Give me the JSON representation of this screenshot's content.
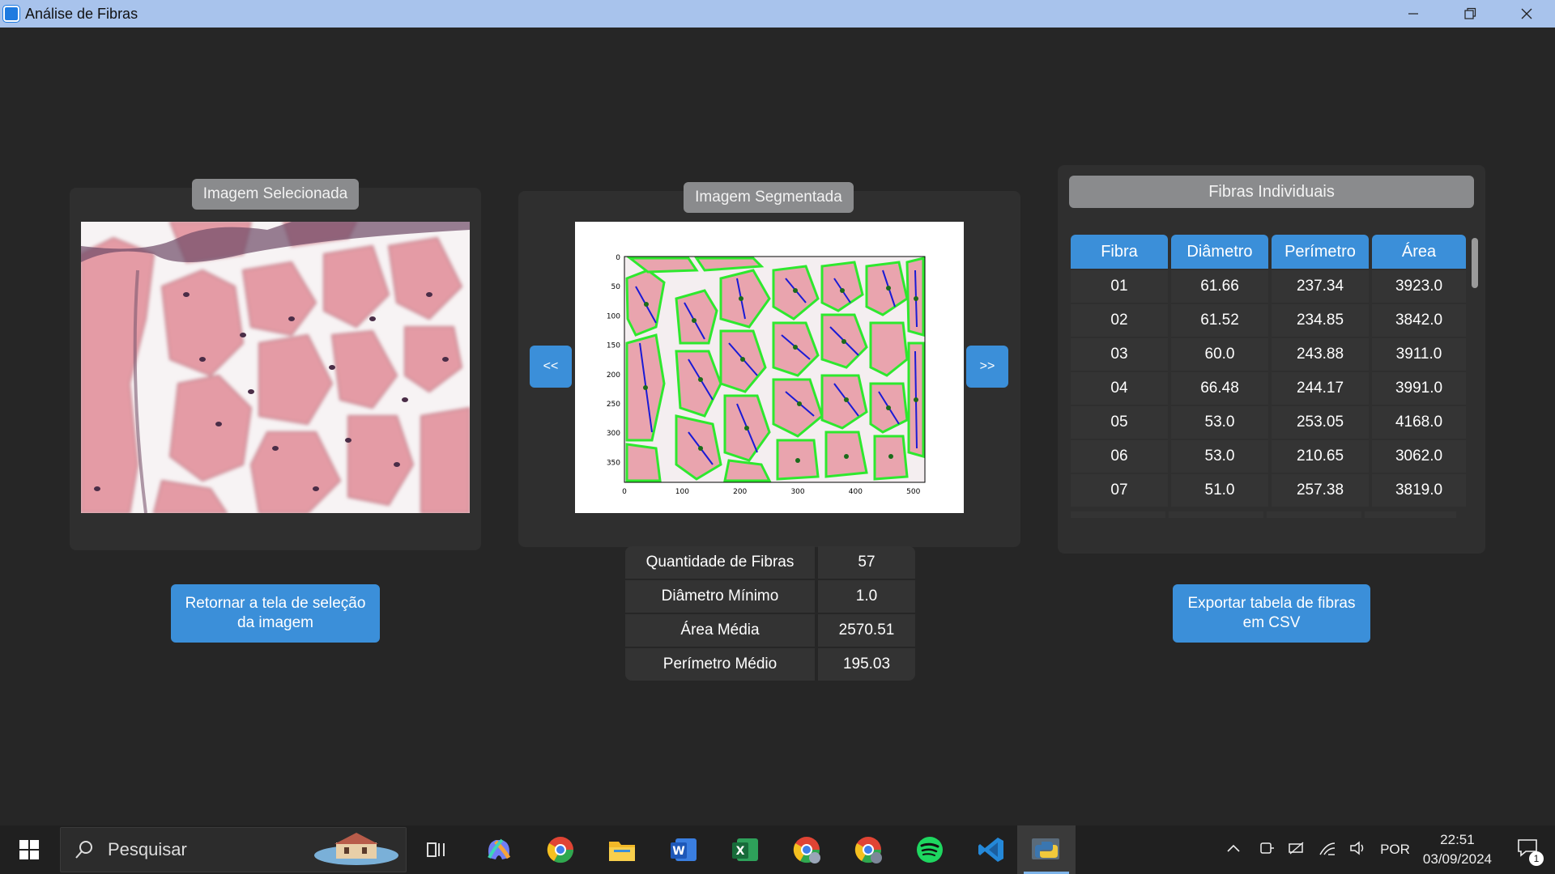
{
  "window": {
    "title": "Análise de Fibras"
  },
  "selected": {
    "label": "Imagem Selecionada"
  },
  "segmented": {
    "label": "Imagem Segmentada",
    "prev": "<<",
    "next": ">>",
    "x_ticks": [
      "0",
      "100",
      "200",
      "300",
      "400",
      "500"
    ],
    "y_ticks": [
      "0",
      "50",
      "100",
      "150",
      "200",
      "250",
      "300",
      "350"
    ]
  },
  "fibras": {
    "title": "Fibras Individuais",
    "headers": [
      "Fibra",
      "Diâmetro",
      "Perímetro",
      "Área"
    ],
    "rows": [
      [
        "01",
        "61.66",
        "237.34",
        "3923.0"
      ],
      [
        "02",
        "61.52",
        "234.85",
        "3842.0"
      ],
      [
        "03",
        "60.0",
        "243.88",
        "3911.0"
      ],
      [
        "04",
        "66.48",
        "244.17",
        "3991.0"
      ],
      [
        "05",
        "53.0",
        "253.05",
        "4168.0"
      ],
      [
        "06",
        "53.0",
        "210.65",
        "3062.0"
      ],
      [
        "07",
        "51.0",
        "257.38",
        "3819.0"
      ]
    ]
  },
  "stats": [
    {
      "label": "Quantidade de Fibras",
      "value": "57"
    },
    {
      "label": "Diâmetro Mínimo",
      "value": "1.0"
    },
    {
      "label": "Área Média",
      "value": "2570.51"
    },
    {
      "label": "Perímetro Médio",
      "value": "195.03"
    }
  ],
  "buttons": {
    "back": "Retornar a tela de seleção da imagem",
    "export": "Exportar tabela de fibras em CSV"
  },
  "taskbar": {
    "search_placeholder": "Pesquisar",
    "lang": "POR",
    "time": "22:51",
    "date": "03/09/2024",
    "notifications": "1"
  },
  "colors": {
    "accent": "#3b8fd9",
    "tissue": "#e8a2ab",
    "contour": "#2ee82e",
    "diameter": "#1a1ad6"
  }
}
